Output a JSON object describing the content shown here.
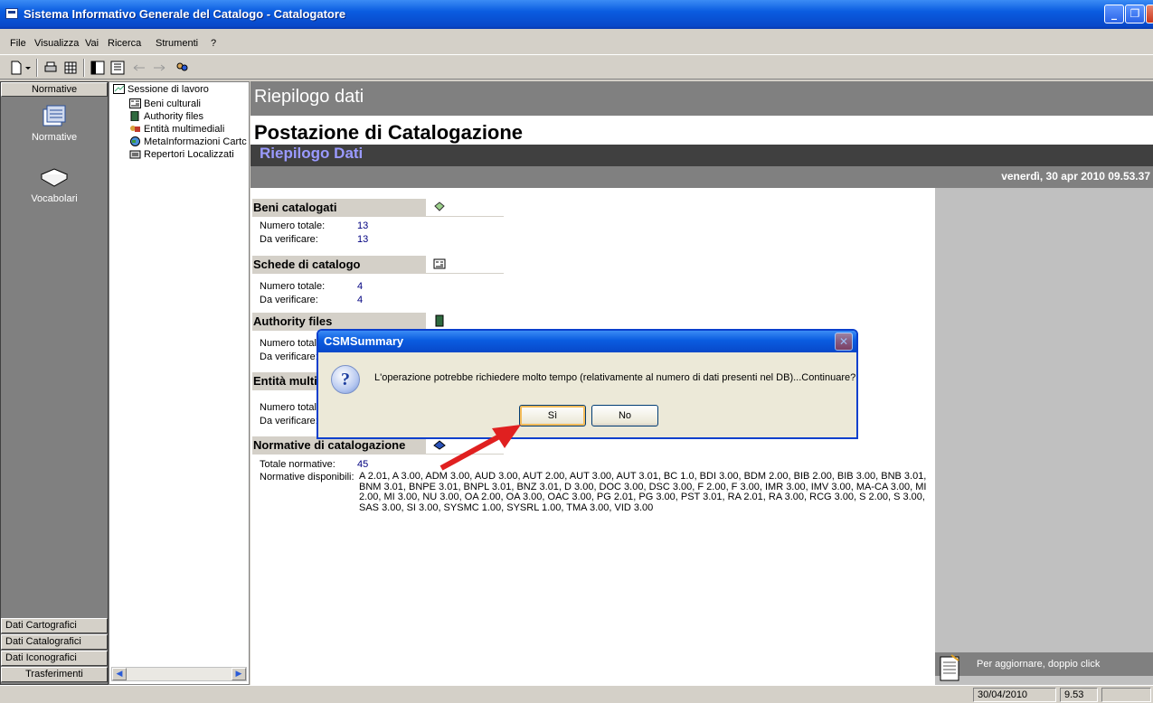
{
  "window": {
    "title": "Sistema Informativo Generale del Catalogo - Catalogatore"
  },
  "menu": [
    "File",
    "Visualizza",
    "Vai",
    "Ricerca",
    "Strumenti",
    "?"
  ],
  "leftnav": {
    "header": "Normative",
    "icons": [
      {
        "label": "Normative",
        "icon": "normative-icon"
      },
      {
        "label": "Vocabolari",
        "icon": "book-icon"
      }
    ],
    "bottom": [
      "Dati Cartografici",
      "Dati Catalografici",
      "Dati Iconografici",
      "Trasferimenti"
    ]
  },
  "tree": {
    "root": "Sessione di lavoro",
    "items": [
      "Beni culturali",
      "Authority files",
      "Entità multimediali",
      "MetaInformazioni Cartc",
      "Repertori Localizzati"
    ]
  },
  "main": {
    "header": "Riepilogo dati",
    "page_title": "Postazione di Catalogazione",
    "subtitle": "Riepilogo Dati",
    "datetime": "venerdì, 30 apr 2010 09.53.37",
    "sections": [
      {
        "title": "Beni catalogati",
        "rows": [
          {
            "label": "Numero totale:",
            "value": "13"
          },
          {
            "label": "Da verificare:",
            "value": "13"
          }
        ]
      },
      {
        "title": "Schede di catalogo",
        "rows": [
          {
            "label": "Numero totale:",
            "value": "4"
          },
          {
            "label": "Da verificare:",
            "value": "4"
          }
        ]
      },
      {
        "title": "Authority files",
        "rows": [
          {
            "label": "Numero totale",
            "value": ""
          },
          {
            "label": "Da verificare:",
            "value": ""
          }
        ]
      },
      {
        "title": "Entità multi",
        "rows": [
          {
            "label": "Numero totale",
            "value": ""
          },
          {
            "label": "Da verificare:",
            "value": ""
          }
        ]
      },
      {
        "title": "Normative di catalogazione",
        "rows": [
          {
            "label": "Totale normative:",
            "value": "45"
          },
          {
            "label": "Normative disponibili:",
            "value": ""
          }
        ]
      }
    ],
    "normative_list": [
      "A 2.01, A 3.00, ADM 3.00, AUD 3.00, AUT 2.00, AUT 3.00, AUT 3.01, BC 1.0, BDI 3.00, BDM 2.00, BIB 2.00, BIB 3.00, BNB 3.01,",
      "BNM 3.01, BNPE 3.01, BNPL 3.01, BNZ 3.01, D 3.00, DOC 3.00, DSC 3.00, F 2.00, F 3.00, IMR 3.00, IMV 3.00, MA-CA 3.00, MI",
      "2.00, MI 3.00, NU 3.00, OA 2.00, OA 3.00, OAC 3.00, PG 2.01, PG 3.00, PST 3.01, RA 2.01, RA 3.00, RCG 3.00, S 2.00, S 3.00,",
      "SAS 3.00, SI 3.00, SYSMC 1.00, SYSRL 1.00, TMA 3.00, VID 3.00"
    ],
    "refresh_hint": "Per aggiornare, doppio click"
  },
  "dialog": {
    "title": "CSMSummary",
    "message": "L'operazione potrebbe richiedere molto tempo (relativamente al numero di dati presenti nel DB)...Continuare?",
    "yes": "Sì",
    "no": "No"
  },
  "status": {
    "date": "30/04/2010",
    "time": "9.53"
  }
}
